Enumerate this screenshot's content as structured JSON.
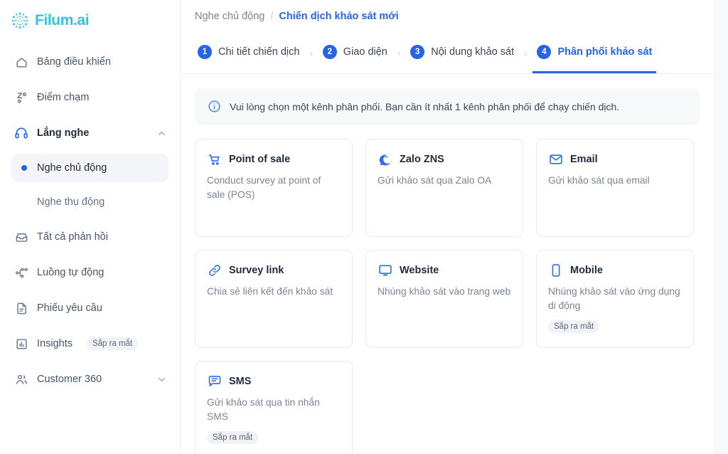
{
  "brand": {
    "name": "Filum.ai",
    "color": "#2fc3e3",
    "accent": "#2563eb"
  },
  "sidebar": {
    "items": [
      {
        "label": "Bảng điều khiển",
        "icon": "home-icon"
      },
      {
        "label": "Điểm chạm",
        "icon": "touchpoint-icon"
      },
      {
        "label": "Lắng nghe",
        "icon": "headphones-icon",
        "chevron": "chevron-up-icon",
        "active": true
      }
    ],
    "sub_items": [
      {
        "label": "Nghe chủ động",
        "selected": true
      },
      {
        "label": "Nghe thụ động",
        "selected": false
      }
    ],
    "items_after": [
      {
        "label": "Tất cả phản hồi",
        "icon": "inbox-icon"
      },
      {
        "label": "Luồng tự động",
        "icon": "workflow-icon"
      },
      {
        "label": "Phiếu yêu cầu",
        "icon": "ticket-icon"
      },
      {
        "label": "Insights",
        "icon": "chart-icon",
        "badge": "Sắp ra mắt"
      },
      {
        "label": "Customer 360",
        "icon": "users-icon",
        "chevron": "chevron-down-icon"
      }
    ]
  },
  "breadcrumb": {
    "parent": "Nghe chủ động",
    "separator": "/",
    "current": "Chiến dịch khảo sát mới"
  },
  "steps": [
    {
      "num": "1",
      "label": "Chi tiết chiến dịch",
      "active": false
    },
    {
      "num": "2",
      "label": "Giao diện",
      "active": false
    },
    {
      "num": "3",
      "label": "Nội dung khảo sát",
      "active": false
    },
    {
      "num": "4",
      "label": "Phân phối khảo sát",
      "active": true
    }
  ],
  "step_separator": "›",
  "info_banner": {
    "icon": "info-icon",
    "text": "Vui lòng chọn một kênh phân phối. Bạn cần ít nhất 1 kênh phân phối để chạy chiến dịch."
  },
  "channels": [
    {
      "title": "Point of sale",
      "desc": "Conduct survey at point of sale (POS)",
      "icon": "shopping-cart-icon",
      "badge": ""
    },
    {
      "title": "Zalo ZNS",
      "desc": "Gửi khảo sát qua Zalo OA",
      "icon": "zalo-icon",
      "badge": ""
    },
    {
      "title": "Email",
      "desc": "Gửi khảo sát qua email",
      "icon": "envelope-icon",
      "badge": ""
    },
    {
      "title": "Survey link",
      "desc": "Chia sẻ liên kết đến khảo sát",
      "icon": "link-icon",
      "badge": ""
    },
    {
      "title": "Website",
      "desc": "Nhúng khảo sát vào trang web",
      "icon": "monitor-icon",
      "badge": ""
    },
    {
      "title": "Mobile",
      "desc": "Nhúng khảo sát vào ứng dụng di động",
      "icon": "smartphone-icon",
      "badge": "Sắp ra mắt"
    },
    {
      "title": "SMS",
      "desc": "Gửi khảo sát qua tin nhắn SMS",
      "icon": "message-icon",
      "badge": "Sắp ra mắt"
    }
  ]
}
